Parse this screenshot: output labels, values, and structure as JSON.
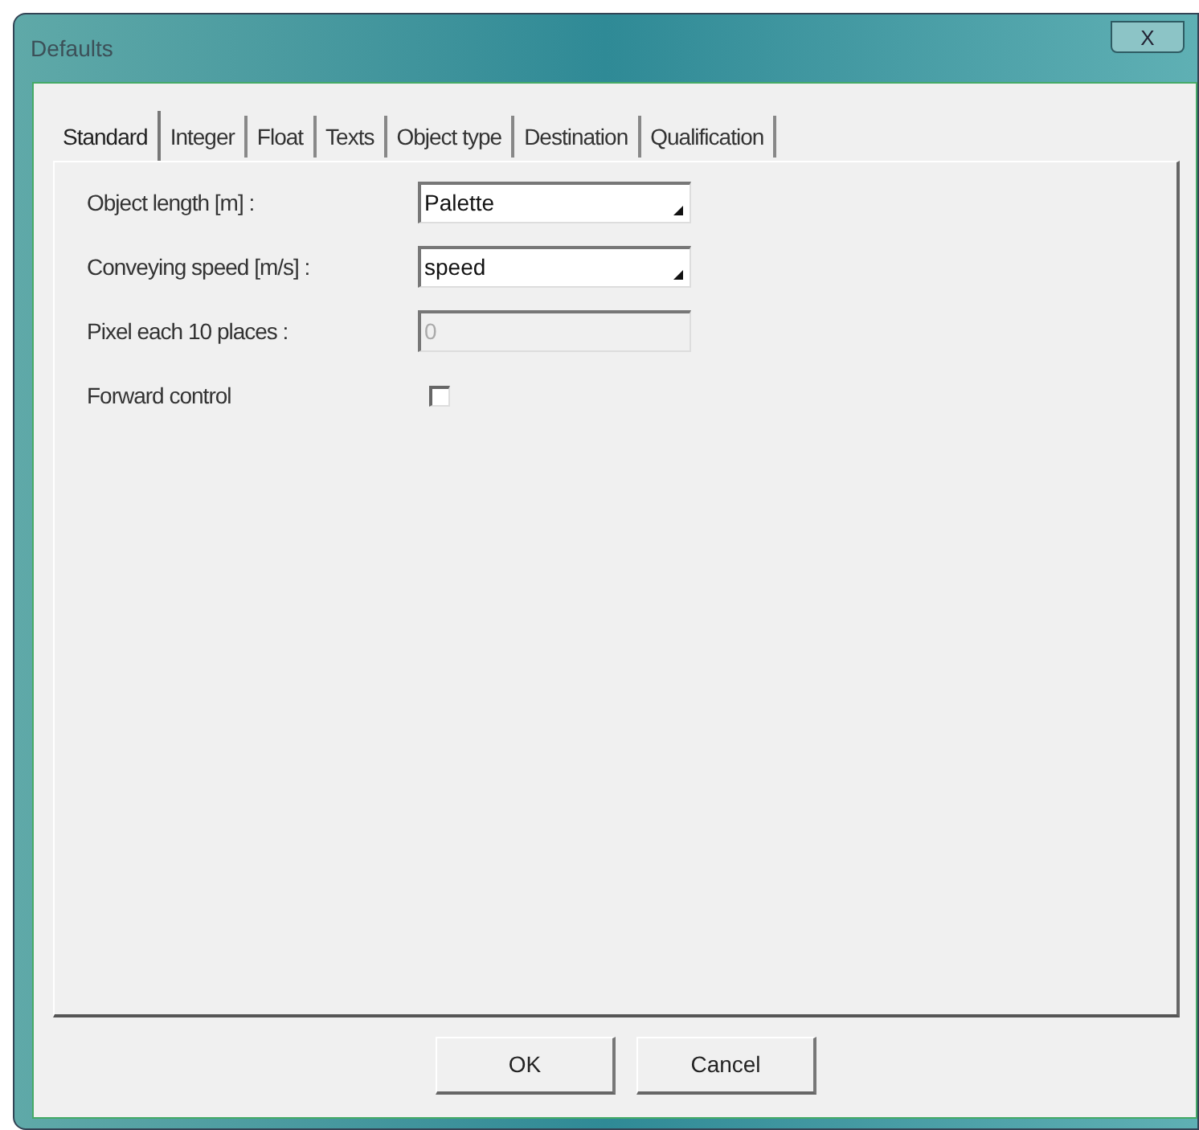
{
  "window": {
    "title": "Defaults",
    "close_label": "X"
  },
  "tabs": [
    {
      "label": "Standard",
      "selected": true
    },
    {
      "label": "Integer",
      "selected": false
    },
    {
      "label": "Float",
      "selected": false
    },
    {
      "label": "Texts",
      "selected": false
    },
    {
      "label": "Object type",
      "selected": false
    },
    {
      "label": "Destination",
      "selected": false
    },
    {
      "label": "Qualification",
      "selected": false
    }
  ],
  "fields": [
    {
      "kind": "dropdown",
      "label": "Object length [m] :",
      "value": "Palette",
      "disabled": false
    },
    {
      "kind": "dropdown",
      "label": "Conveying speed [m/s] :",
      "value": "speed",
      "disabled": false
    },
    {
      "kind": "text",
      "label": "Pixel each 10 places :",
      "value": "0",
      "disabled": true
    },
    {
      "kind": "checkbox",
      "label": "Forward control",
      "checked": false
    }
  ],
  "buttons": [
    "OK",
    "Cancel"
  ]
}
